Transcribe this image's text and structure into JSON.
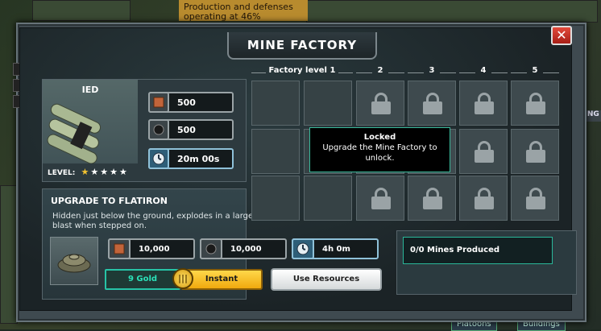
{
  "background": {
    "top_banner_lines": [
      "Production and defenses",
      "operating at 46%"
    ],
    "bottom_tabs": [
      "Platoons",
      "Buildings"
    ],
    "right_tab": "NING"
  },
  "dialog": {
    "title": "MINE FACTORY",
    "close_label": "✕"
  },
  "item": {
    "name": "IED",
    "level_label": "LEVEL:",
    "level_stars_filled": 1,
    "level_stars_total": 5,
    "costs": [
      {
        "icon": "metal-crate-icon",
        "value": "500"
      },
      {
        "icon": "oil-splat-icon",
        "value": "500"
      },
      {
        "icon": "clock-icon",
        "value": "20m 00s"
      }
    ]
  },
  "upgrade": {
    "title": "UPGRADE TO FLATIRON",
    "description": "Hidden just below the ground, explodes in a large blast when stepped on.",
    "costs": [
      {
        "icon": "metal-crate-icon",
        "value": "10,000"
      },
      {
        "icon": "oil-splat-icon",
        "value": "10,000"
      },
      {
        "icon": "clock-icon",
        "value": "4h 0m"
      }
    ],
    "gold_cost": "9 Gold",
    "instant_label": "Instant",
    "use_resources_label": "Use Resources"
  },
  "grid": {
    "columns": [
      "Factory level 1",
      "2",
      "3",
      "4",
      "5"
    ],
    "rows": 3
  },
  "tooltip": {
    "title": "Locked",
    "body": "Upgrade the Mine Factory to unlock."
  },
  "production": {
    "status": "0/0 Mines Produced"
  },
  "colors": {
    "accent_teal": "#2ab79a",
    "gold": "#f0a90e",
    "close_red": "#c43325"
  }
}
